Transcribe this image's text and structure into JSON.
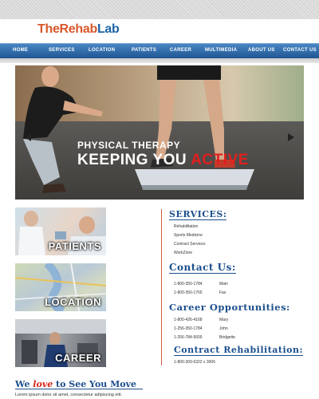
{
  "logo": {
    "part1": "TheRehab",
    "part2": "Lab"
  },
  "nav": [
    "HOME",
    "SERVICES",
    "LOCATION",
    "PATIENTS",
    "CAREER",
    "MULTIMEDIA",
    "ABOUT US",
    "CONTACT US"
  ],
  "hero": {
    "line1": "PHYSICAL THERAPY",
    "line2a": "KEEPING YOU ",
    "line2b": "ACTIVE"
  },
  "tiles": {
    "patients": "PATIENTS",
    "location": "LOCATION",
    "career": "CAREER"
  },
  "services": {
    "title": "SERVICES:",
    "items": [
      "Rehabilitation",
      "Sports Medicine",
      "Contract Services",
      "WorkZone"
    ]
  },
  "contact": {
    "title": "Contact Us:",
    "rows": [
      [
        "1-800-350-1784",
        "Main"
      ],
      [
        "1-800-350-1765",
        "Fax"
      ]
    ]
  },
  "career": {
    "title": "Career Opportunities:",
    "rows": [
      [
        "1-800-426-4168",
        "Mary"
      ],
      [
        "1-256-350-1784",
        "John"
      ],
      [
        "1-256-784-5600",
        "Bridgette"
      ]
    ]
  },
  "contract": {
    "title": "Contract Rehabilitation:",
    "phone": "1-800-309-6322 x 3006"
  },
  "welcome": {
    "a": "We ",
    "b": "love",
    "c": " to See You Move",
    "body": "Lorem ipsum dolor sit amet, consectetur adipiscing elit."
  }
}
